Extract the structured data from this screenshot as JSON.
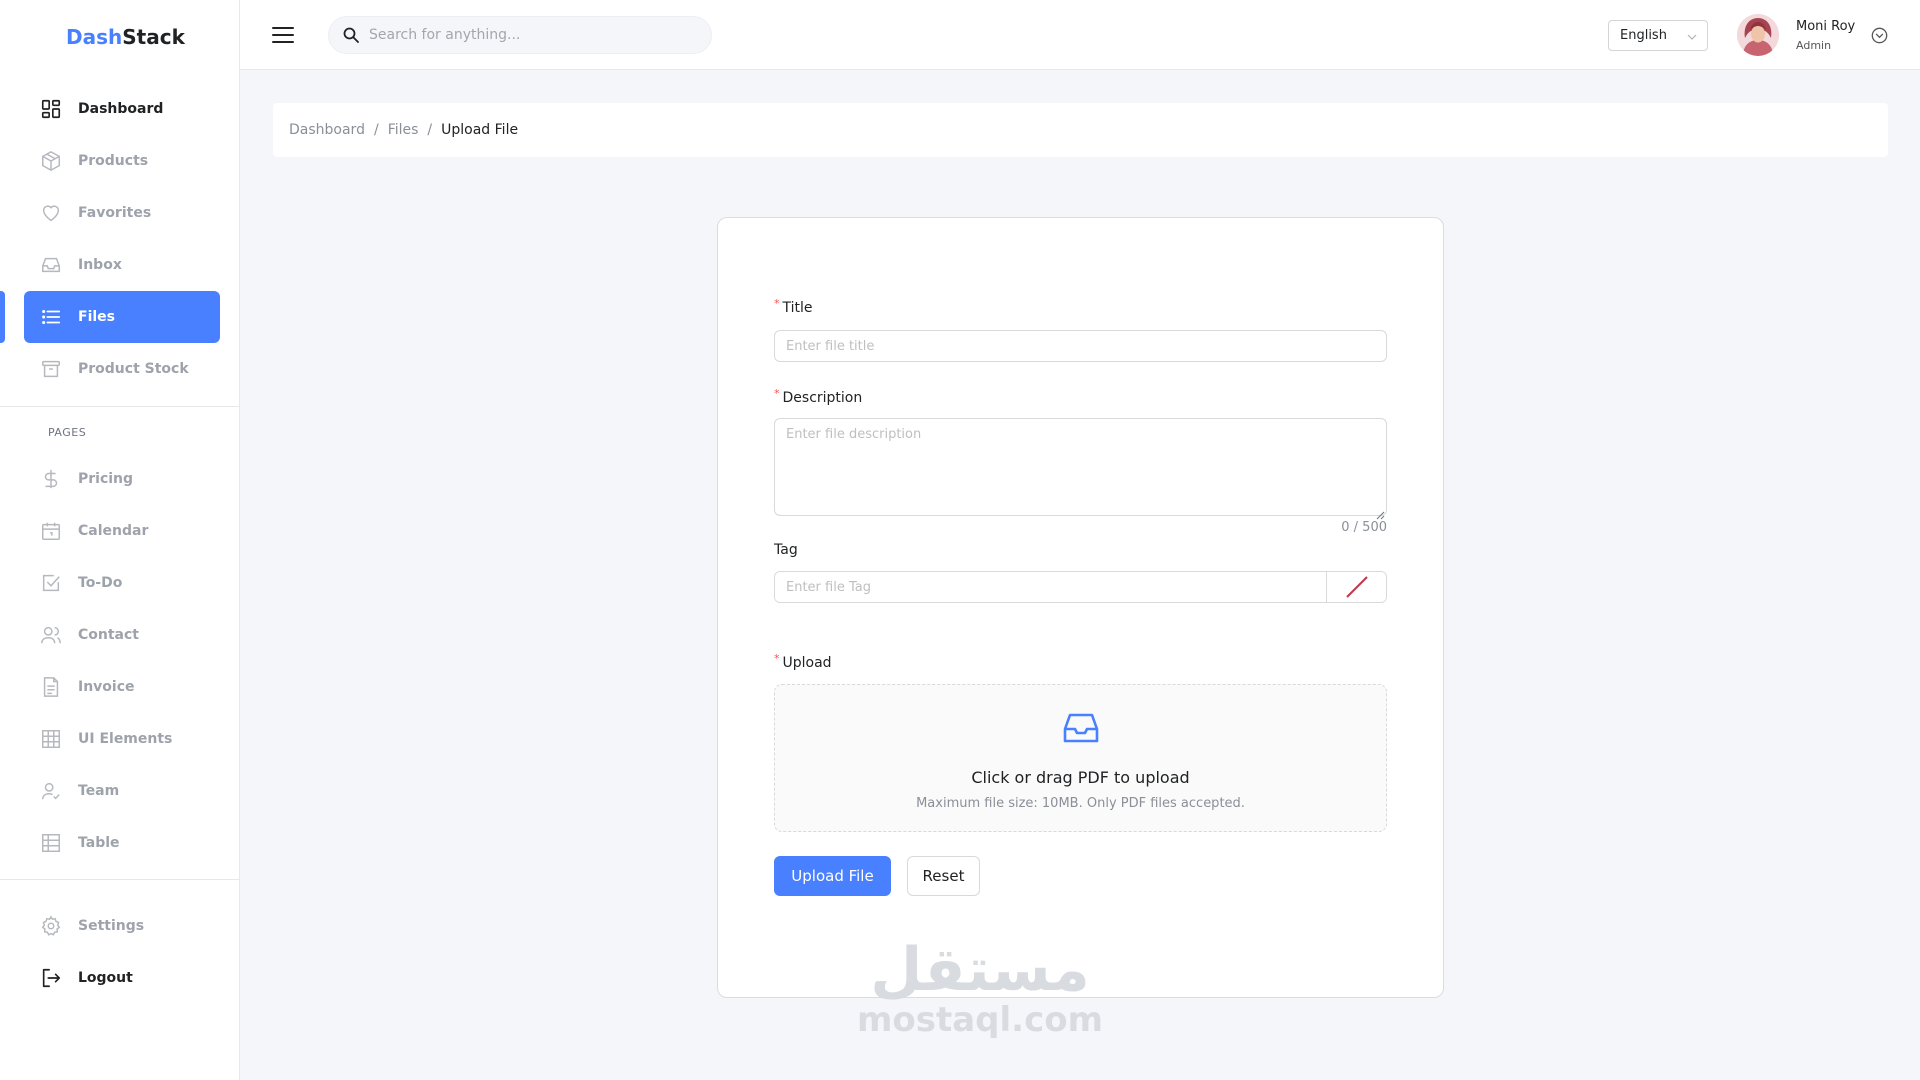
{
  "brand": {
    "part1": "Dash",
    "part2": "Stack",
    "accent_color": "#4880ff"
  },
  "sidebar": {
    "main_items": [
      {
        "label": "Dashboard",
        "icon": "dashboard-icon"
      },
      {
        "label": "Products",
        "icon": "cube-icon"
      },
      {
        "label": "Favorites",
        "icon": "heart-icon"
      },
      {
        "label": "Inbox",
        "icon": "inbox-icon"
      },
      {
        "label": "Files",
        "icon": "list-icon",
        "active": true
      },
      {
        "label": "Product Stock",
        "icon": "archive-icon"
      }
    ],
    "pages_section_label": "PAGES",
    "page_items": [
      {
        "label": "Pricing",
        "icon": "dollar-icon"
      },
      {
        "label": "Calendar",
        "icon": "calendar-icon"
      },
      {
        "label": "To-Do",
        "icon": "checkbox-icon"
      },
      {
        "label": "Contact",
        "icon": "users-icon"
      },
      {
        "label": "Invoice",
        "icon": "document-icon"
      },
      {
        "label": "UI Elements",
        "icon": "grid-icon"
      },
      {
        "label": "Team",
        "icon": "team-icon"
      },
      {
        "label": "Table",
        "icon": "table-icon"
      }
    ],
    "bottom_items": [
      {
        "label": "Settings",
        "icon": "gear-icon"
      },
      {
        "label": "Logout",
        "icon": "logout-icon"
      }
    ]
  },
  "header": {
    "search_placeholder": "Search for anything...",
    "language": "English",
    "user": {
      "name": "Moni Roy",
      "role": "Admin"
    }
  },
  "breadcrumb": {
    "items": [
      "Dashboard",
      "Files"
    ],
    "separator": "/",
    "current": "Upload File"
  },
  "form": {
    "required_mark": "*",
    "title": {
      "label": "Title",
      "placeholder": "Enter file title",
      "value": ""
    },
    "description": {
      "label": "Description",
      "placeholder": "Enter file description",
      "value": "",
      "counter": "0 / 500"
    },
    "tag": {
      "label": "Tag",
      "placeholder": "Enter file Tag",
      "value": ""
    },
    "upload": {
      "label": "Upload",
      "title": "Click or drag PDF to upload",
      "hint": "Maximum file size: 10MB. Only PDF files accepted."
    },
    "submit_label": "Upload File",
    "reset_label": "Reset"
  },
  "watermark": {
    "arabic": "مستقل",
    "latin": "mostaql.com"
  }
}
